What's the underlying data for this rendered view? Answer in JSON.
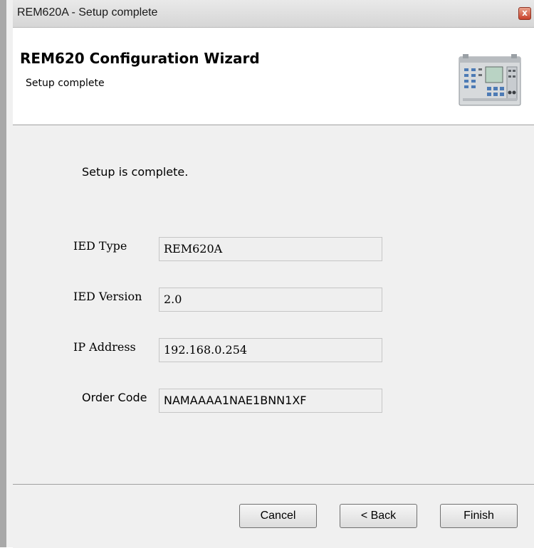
{
  "window": {
    "title": "REM620A - Setup complete",
    "close_glyph": "x"
  },
  "header": {
    "title": "REM620 Configuration Wizard",
    "subtitle": "Setup complete",
    "image": "relay-device-image"
  },
  "content": {
    "message": "Setup is complete.",
    "fields": {
      "ied_type": {
        "label": "IED Type",
        "value": "REM620A"
      },
      "ied_version": {
        "label": "IED Version",
        "value": "2.0"
      },
      "ip_address": {
        "label": "IP Address",
        "value": "192.168.0.254"
      },
      "order_code": {
        "label": "Order Code",
        "value": "NAMAAAA1NAE1BNN1XF"
      }
    }
  },
  "buttons": {
    "cancel": "Cancel",
    "back": "< Back",
    "finish": "Finish"
  },
  "colors": {
    "dialog_background": "#f0f0f0",
    "header_background": "#ffffff",
    "close_button": "#c8412a"
  }
}
